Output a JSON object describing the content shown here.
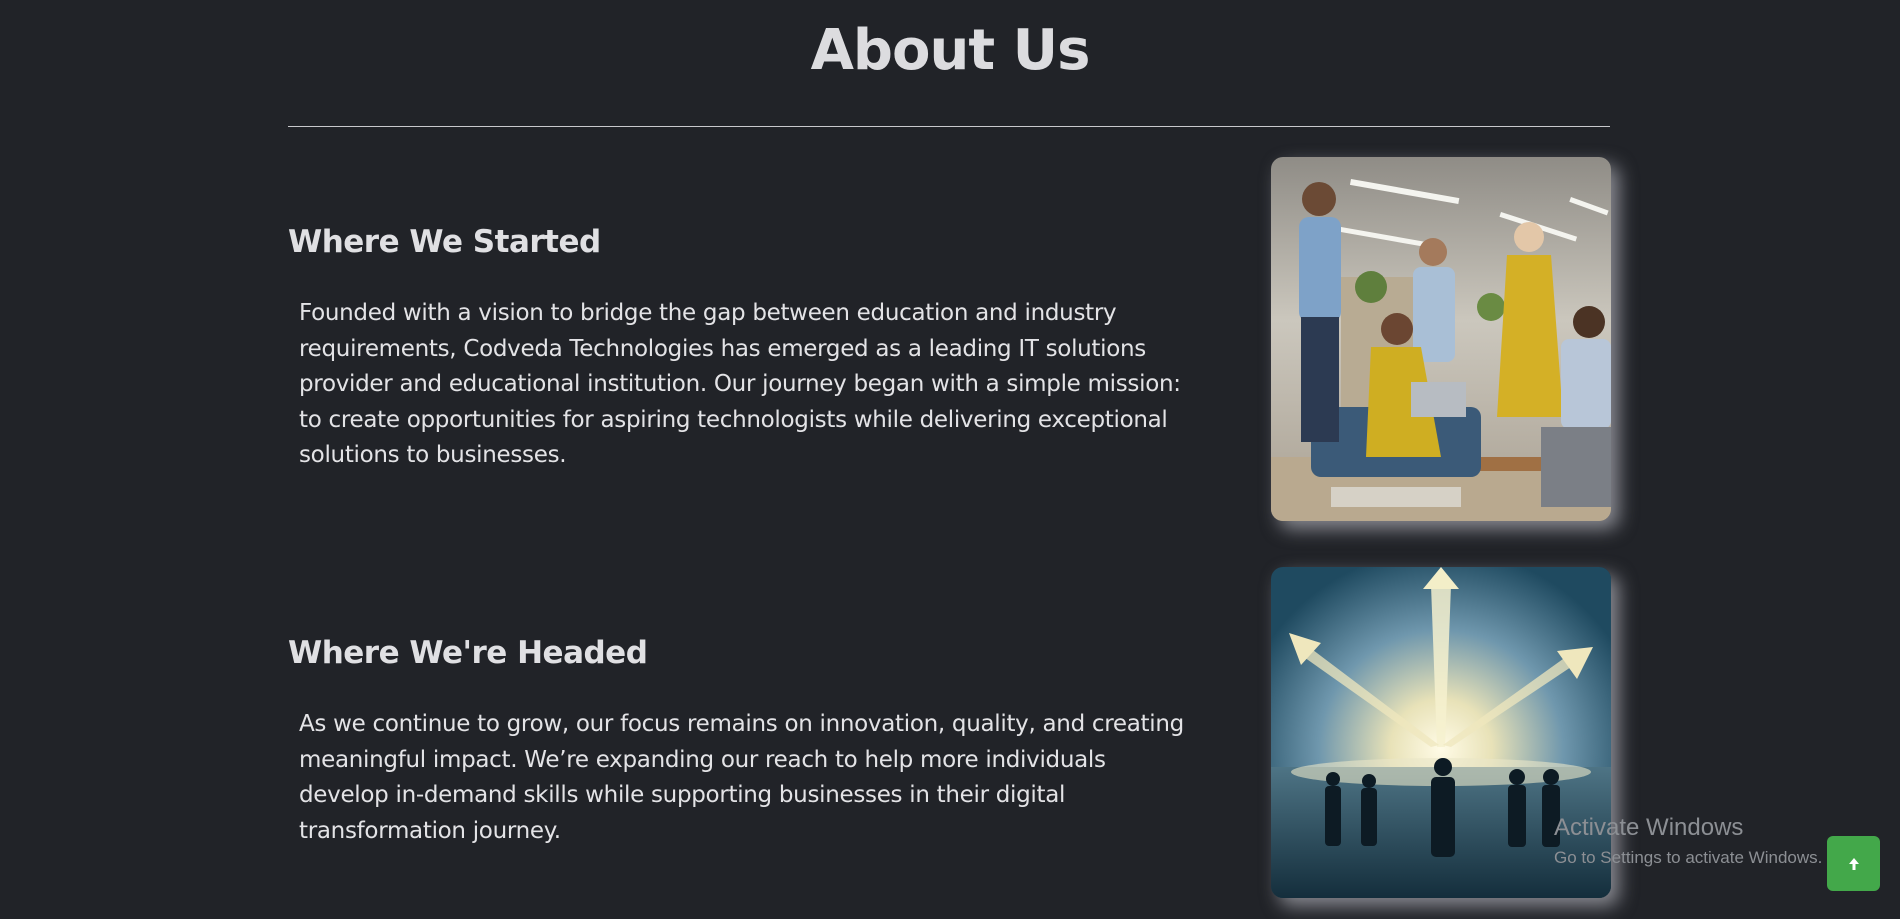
{
  "page": {
    "title": "About Us"
  },
  "sections": [
    {
      "heading": "Where We Started",
      "text": "Founded with a vision to bridge the gap between education and industry requirements, Codveda Technologies has emerged as a leading IT solutions provider and educational institution. Our journey began with a simple mission: to create opportunities for aspiring technologists while delivering exceptional solutions to businesses."
    },
    {
      "heading": "Where We're Headed",
      "text": "As we continue to grow, our focus remains on innovation, quality, and creating meaningful impact. We’re expanding our reach to help more individuals develop in-demand skills while supporting businesses in their digital transformation journey."
    }
  ],
  "watermark": {
    "title": "Activate Windows",
    "subtitle": "Go to Settings to activate Windows."
  },
  "scroll_top_button": {
    "icon": "arrow-up-icon"
  },
  "colors": {
    "background": "#212328",
    "text": "#e0e0e3",
    "accent": "#43a84a"
  }
}
